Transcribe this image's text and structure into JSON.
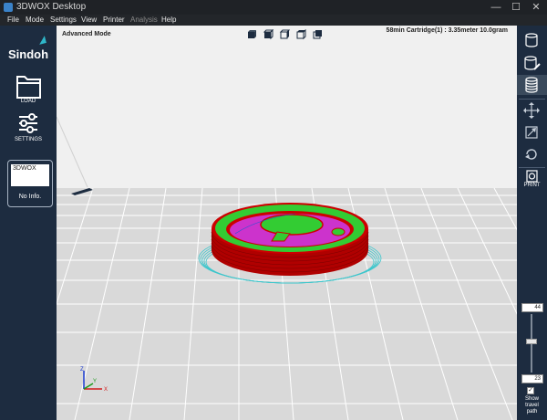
{
  "window": {
    "title": "3DWOX Desktop",
    "min_glyph": "—",
    "max_glyph": "☐",
    "close_glyph": "✕"
  },
  "menu": {
    "items": [
      "File",
      "Mode",
      "Settings",
      "View",
      "Printer",
      "Analysis",
      "Help"
    ],
    "disabled": [
      "Analysis"
    ]
  },
  "left_panel": {
    "logo_text": "Sindoh",
    "load_label": "LOAD",
    "settings_label": "SETTINGS",
    "model_card": {
      "name": "3DWOX",
      "info": "No Info."
    }
  },
  "viewport": {
    "mode_label": "Advanced Mode",
    "print_info": "58min  Cartridge(1) : 3.35meter 10.0gram",
    "view_buttons": [
      "view-iso-icon",
      "view-front-icon",
      "view-side-icon",
      "view-top-icon",
      "view-back-icon"
    ],
    "axes": {
      "x": "X",
      "y": "Y",
      "z": "Z"
    },
    "colors": {
      "bed": "#d9d9d9",
      "grid": "#ffffff",
      "wall": "#cc0000",
      "infill": "#33cc33",
      "top_skin": "#cc33cc",
      "skirt": "#3cc6cc"
    }
  },
  "right_panel": {
    "buttons": [
      {
        "icon": "layer-view-icon",
        "active": false
      },
      {
        "icon": "model-edit-icon",
        "active": false
      },
      {
        "icon": "layers-stack-icon",
        "active": true
      },
      {
        "icon": "move-icon",
        "active": false
      },
      {
        "icon": "scale-icon",
        "active": false
      },
      {
        "icon": "rotate-icon",
        "active": false
      },
      {
        "icon": "print-icon",
        "active": false
      }
    ],
    "print_label": "PRINT",
    "layer_slider": {
      "top_value": "44",
      "bottom_value": "23"
    },
    "show_travel": {
      "checked_glyph": "✓",
      "label_line1": "Show",
      "label_line2": "travel",
      "label_line3": "path"
    }
  }
}
